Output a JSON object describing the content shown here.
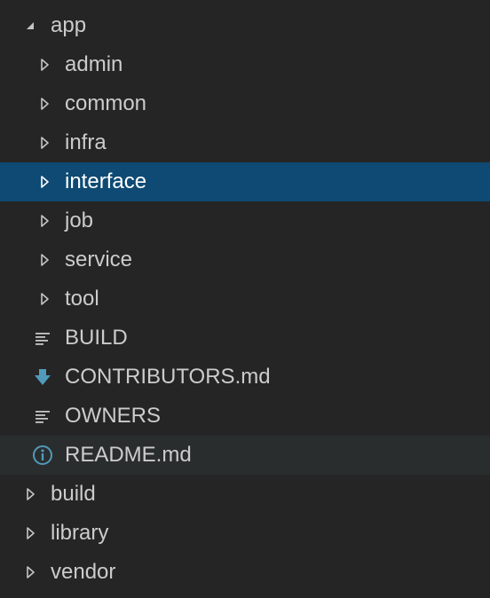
{
  "explorer": {
    "items": [
      {
        "label": "app",
        "level": 0,
        "kind": "folder",
        "expanded": true,
        "icon": "chevron-down-icon"
      },
      {
        "label": "admin",
        "level": 1,
        "kind": "folder",
        "expanded": false,
        "icon": "chevron-right-icon"
      },
      {
        "label": "common",
        "level": 1,
        "kind": "folder",
        "expanded": false,
        "icon": "chevron-right-icon"
      },
      {
        "label": "infra",
        "level": 1,
        "kind": "folder",
        "expanded": false,
        "icon": "chevron-right-icon"
      },
      {
        "label": "interface",
        "level": 1,
        "kind": "folder",
        "expanded": false,
        "selected": true,
        "icon": "chevron-right-icon"
      },
      {
        "label": "job",
        "level": 1,
        "kind": "folder",
        "expanded": false,
        "icon": "chevron-right-icon"
      },
      {
        "label": "service",
        "level": 1,
        "kind": "folder",
        "expanded": false,
        "icon": "chevron-right-icon"
      },
      {
        "label": "tool",
        "level": 1,
        "kind": "folder",
        "expanded": false,
        "icon": "chevron-right-icon"
      },
      {
        "label": "BUILD",
        "level": 1,
        "kind": "file",
        "icon": "text-lines-icon"
      },
      {
        "label": "CONTRIBUTORS.md",
        "level": 1,
        "kind": "file",
        "icon": "download-arrow-icon"
      },
      {
        "label": "OWNERS",
        "level": 1,
        "kind": "file",
        "icon": "text-lines-icon"
      },
      {
        "label": "README.md",
        "level": 1,
        "kind": "file",
        "hover": true,
        "icon": "info-circle-icon"
      },
      {
        "label": "build",
        "level": 0,
        "kind": "folder",
        "expanded": false,
        "icon": "chevron-right-icon"
      },
      {
        "label": "library",
        "level": 0,
        "kind": "folder",
        "expanded": false,
        "icon": "chevron-right-icon"
      },
      {
        "label": "vendor",
        "level": 0,
        "kind": "folder",
        "expanded": false,
        "icon": "chevron-right-icon"
      }
    ]
  },
  "colors": {
    "background": "#252526",
    "selected_background": "#0e4a73",
    "hover_background": "#2a2d2e",
    "text": "#cccccc",
    "icon_blue": "#519aba"
  }
}
